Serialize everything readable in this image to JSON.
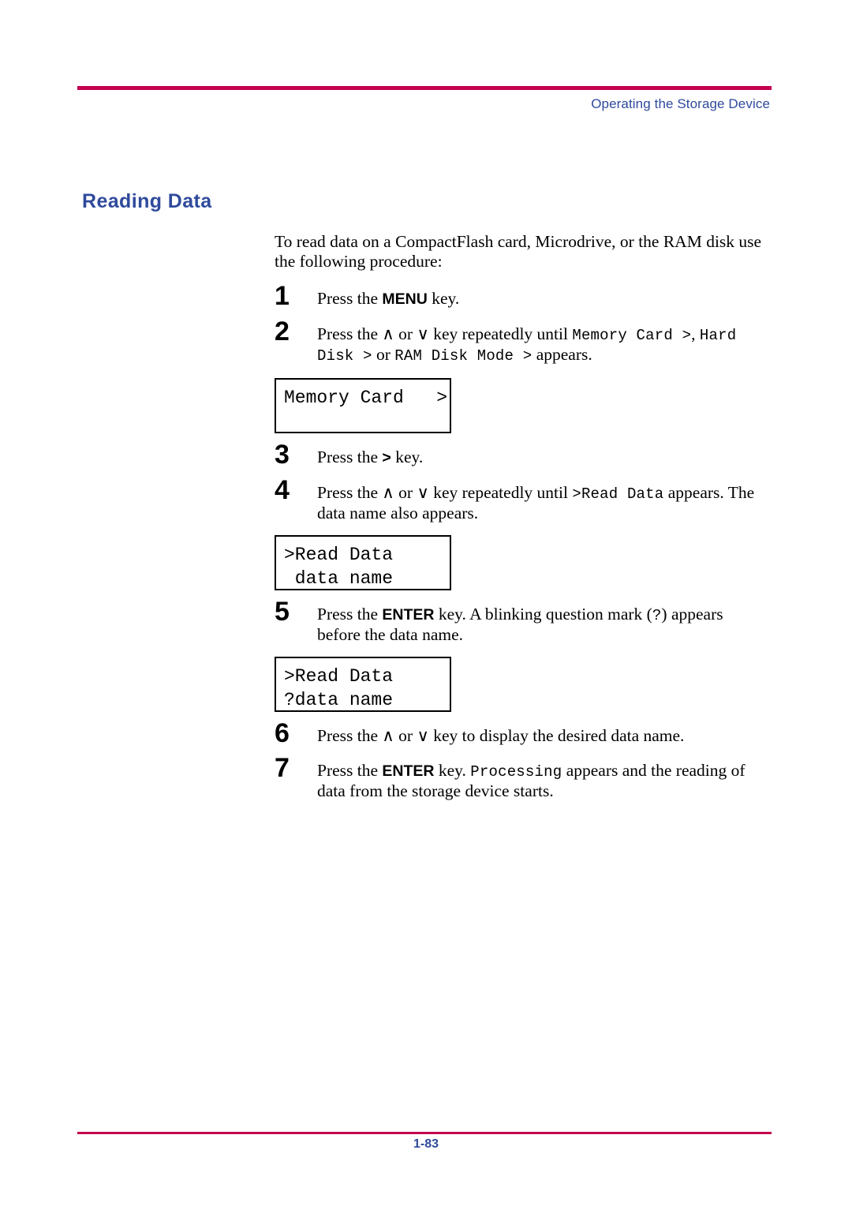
{
  "header": {
    "title": "Operating the Storage Device",
    "rule_color": "#c4004f",
    "text_color": "#2f4a9c"
  },
  "section": {
    "heading": "Reading Data"
  },
  "intro": {
    "text": "To read data on a CompactFlash card, Microdrive, or the RAM disk use the following procedure:"
  },
  "steps": {
    "s1": {
      "num": "1",
      "a": "Press the ",
      "key": "MENU",
      "b": " key."
    },
    "s2": {
      "num": "2",
      "a": "Press the ",
      "up": "∧",
      "or": " or ",
      "down": "∨",
      "b": " key repeatedly until ",
      "m1": "Memory Card >",
      "c": ", ",
      "m2": "Hard Disk >",
      "d": " or ",
      "m3": "RAM Disk Mode >",
      "e": " appears."
    },
    "s3": {
      "num": "3",
      "a": "Press the ",
      "key": ">",
      "b": " key."
    },
    "s4": {
      "num": "4",
      "a": "Press the ",
      "up": "∧",
      "or": " or ",
      "down": "∨",
      "b": " key repeatedly until ",
      "m1": ">Read Data",
      "c": " appears. The data name also appears."
    },
    "s5": {
      "num": "5",
      "a": "Press the ",
      "key": "ENTER",
      "b": " key. A blinking question mark (",
      "m1": "?",
      "c": ") appears before the data name."
    },
    "s6": {
      "num": "6",
      "a": "Press the ",
      "up": "∧",
      "or": " or ",
      "down": "∨",
      "b": " key to display the desired data name."
    },
    "s7": {
      "num": "7",
      "a": "Press the ",
      "key": "ENTER",
      "b": " key. ",
      "m1": "Processing",
      "c": " appears and the reading of data from the storage device starts."
    }
  },
  "lcd_panels": {
    "panel1": {
      "line1": "Memory Card   >",
      "line2": ""
    },
    "panel2": {
      "line1": ">Read Data",
      "line2": " data name"
    },
    "panel3": {
      "line1": ">Read Data",
      "line2": "?data name"
    }
  },
  "footer": {
    "page_number": "1-83",
    "rule_color": "#c4004f",
    "text_color": "#2f4a9c"
  }
}
